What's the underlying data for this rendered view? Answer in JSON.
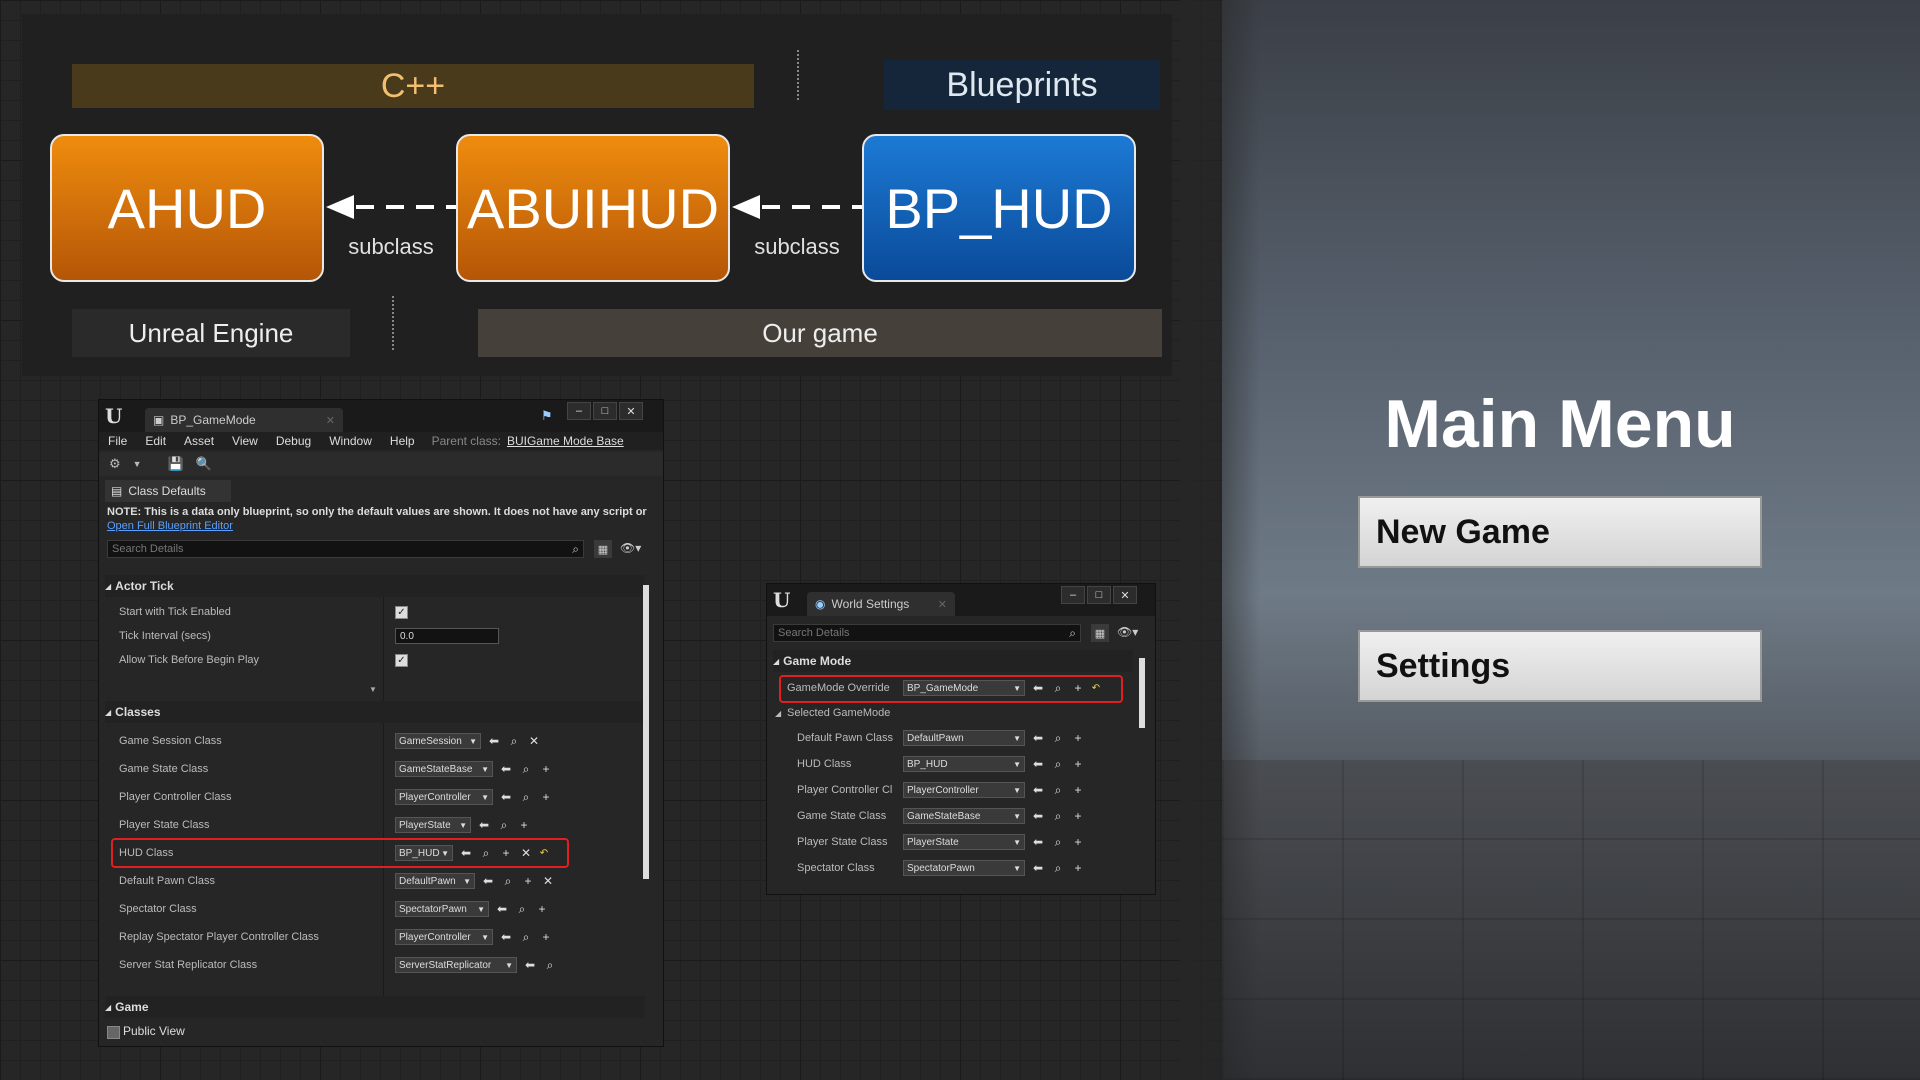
{
  "diagram": {
    "cpp_header": "C++",
    "bp_header": "Blueprints",
    "nodes": [
      "AHUD",
      "ABUIHUD",
      "BP_HUD"
    ],
    "arrow_label": "subclass",
    "footer_engine": "Unreal Engine",
    "footer_game": "Our game"
  },
  "gamemode_window": {
    "tab_title": "BP_GameMode",
    "menu": [
      "File",
      "Edit",
      "Asset",
      "View",
      "Debug",
      "Window",
      "Help"
    ],
    "parent_class_label": "Parent class:",
    "parent_class_value": "BUIGame Mode Base",
    "subtab": "Class Defaults",
    "note": "NOTE: This is a data only blueprint, so only the default values are shown.  It does not have any script or",
    "link": "Open Full Blueprint Editor",
    "search_placeholder": "Search Details",
    "actor_tick": {
      "title": "Actor Tick",
      "start_with_tick": "Start with Tick Enabled",
      "tick_interval": "Tick Interval (secs)",
      "tick_interval_value": "0.0",
      "allow_tick": "Allow Tick Before Begin Play"
    },
    "classes_title": "Classes",
    "classes": [
      {
        "label": "Game Session Class",
        "value": "GameSession"
      },
      {
        "label": "Game State Class",
        "value": "GameStateBase"
      },
      {
        "label": "Player Controller Class",
        "value": "PlayerController"
      },
      {
        "label": "Player State Class",
        "value": "PlayerState"
      },
      {
        "label": "HUD Class",
        "value": "BP_HUD"
      },
      {
        "label": "Default Pawn Class",
        "value": "DefaultPawn"
      },
      {
        "label": "Spectator Class",
        "value": "SpectatorPawn"
      },
      {
        "label": "Replay Spectator Player Controller Class",
        "value": "PlayerController"
      },
      {
        "label": "Server Stat Replicator Class",
        "value": "ServerStatReplicator"
      }
    ],
    "game_title": "Game",
    "public_view": "Public View"
  },
  "world_window": {
    "tab_title": "World Settings",
    "search_placeholder": "Search Details",
    "game_mode_title": "Game Mode",
    "override_label": "GameMode Override",
    "override_value": "BP_GameMode",
    "selected_title": "Selected GameMode",
    "rows": [
      {
        "label": "Default Pawn Class",
        "value": "DefaultPawn"
      },
      {
        "label": "HUD Class",
        "value": "BP_HUD"
      },
      {
        "label": "Player Controller Cl",
        "value": "PlayerController"
      },
      {
        "label": "Game State Class",
        "value": "GameStateBase"
      },
      {
        "label": "Player State Class",
        "value": "PlayerState"
      },
      {
        "label": "Spectator Class",
        "value": "SpectatorPawn"
      }
    ]
  },
  "game_menu": {
    "title": "Main Menu",
    "buttons": [
      "New Game",
      "Settings"
    ]
  }
}
